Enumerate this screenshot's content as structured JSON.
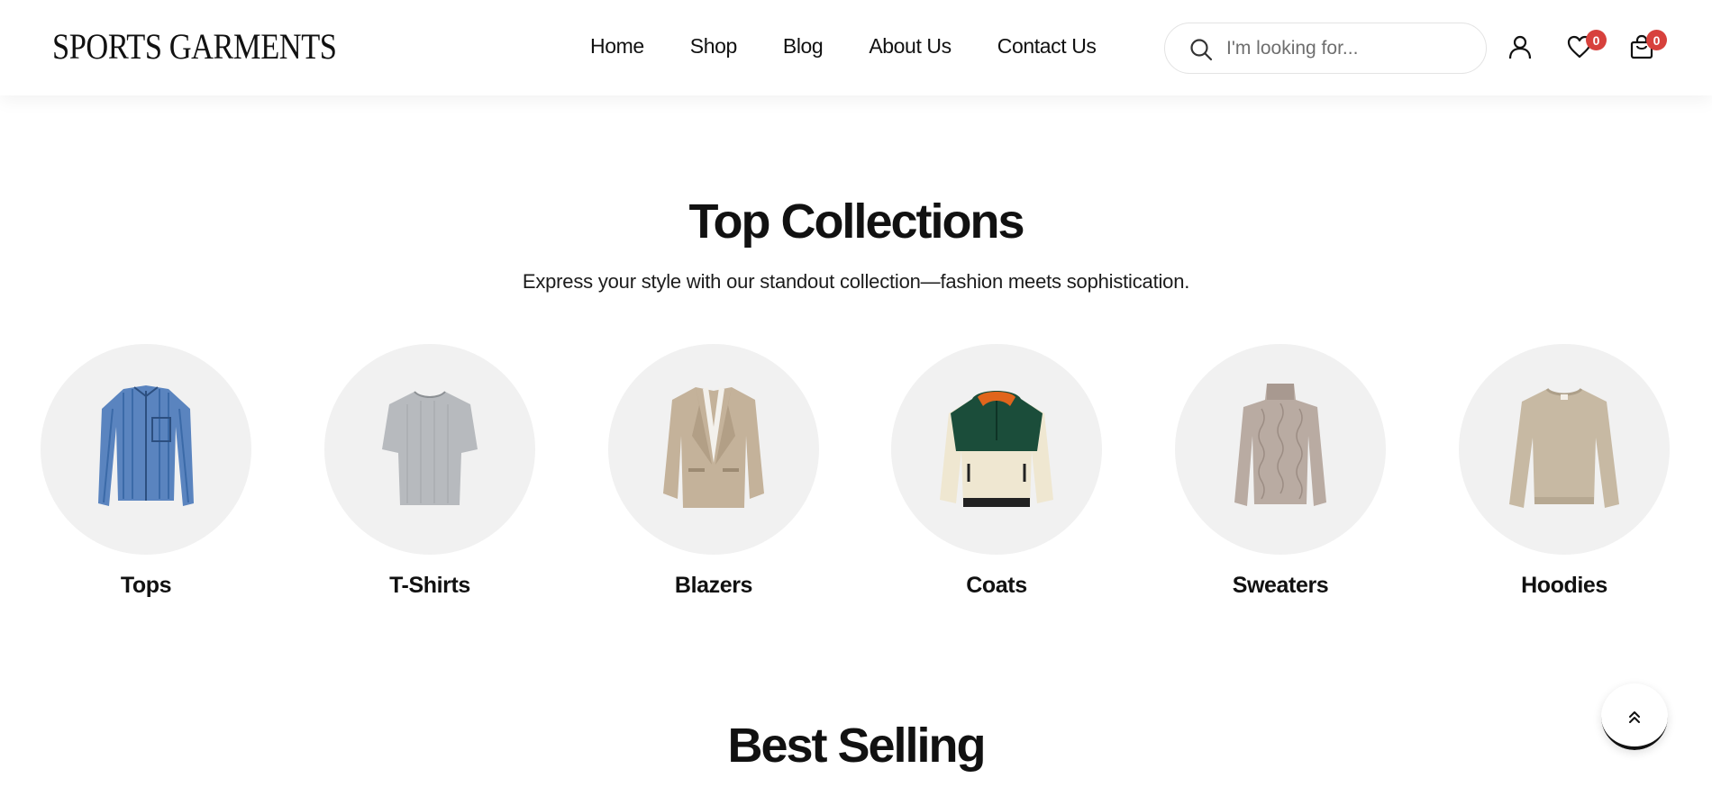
{
  "brand": {
    "logo_text": "SPORTS GARMENTS"
  },
  "nav": {
    "items": [
      {
        "label": "Home"
      },
      {
        "label": "Shop"
      },
      {
        "label": "Blog"
      },
      {
        "label": "About Us"
      },
      {
        "label": "Contact Us"
      }
    ]
  },
  "search": {
    "placeholder": "I'm looking for...",
    "value": ""
  },
  "header_icons": {
    "account": "user-icon",
    "wishlist": "heart-icon",
    "wishlist_count": "0",
    "cart": "shopping-bag-icon",
    "cart_count": "0",
    "badge_color": "#d7413c"
  },
  "top_collections": {
    "title": "Top Collections",
    "subtitle": "Express your style with our standout collection—fashion meets sophistication.",
    "items": [
      {
        "label": "Tops",
        "image": "striped-shirt"
      },
      {
        "label": "T-Shirts",
        "image": "grey-tshirt"
      },
      {
        "label": "Blazers",
        "image": "beige-blazer"
      },
      {
        "label": "Coats",
        "image": "fleece-pullover"
      },
      {
        "label": "Sweaters",
        "image": "turtleneck-sweater"
      },
      {
        "label": "Hoodies",
        "image": "crewneck-sweatshirt"
      }
    ]
  },
  "best_selling": {
    "title": "Best Selling"
  },
  "scroll_top": {
    "icon": "double-chevron-up-icon"
  }
}
